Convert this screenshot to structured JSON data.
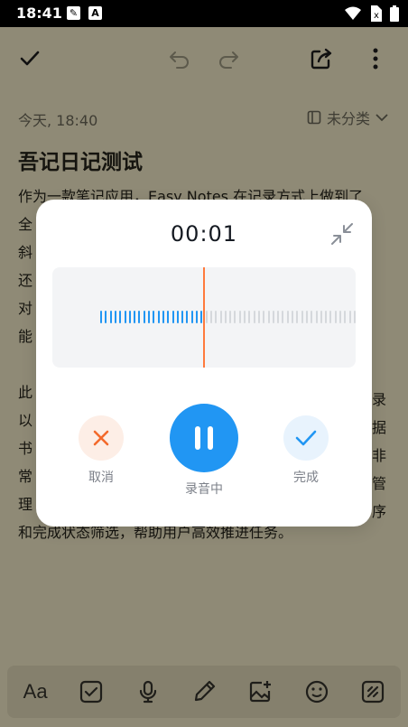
{
  "status_bar": {
    "time": "18:41",
    "icons": [
      "edit-notify-icon",
      "font-a-icon",
      "wifi-icon",
      "no-sim-icon",
      "battery-icon"
    ]
  },
  "toolbar": {
    "icons": [
      "check-icon",
      "undo-icon",
      "redo-icon",
      "share-icon",
      "more-vert-icon"
    ]
  },
  "note": {
    "date": "今天, 18:40",
    "category": "未分类",
    "title": "吾记日记测试",
    "lines": [
      "作为一款笔记应用，Easy Notes 在记录方式上做到了",
      "全",
      "斜",
      "还",
      "对",
      "能",
      "",
      "此",
      "以",
      "书",
      "常",
      "理",
      "和完成状态筛选，帮助用户高效推进任务。"
    ],
    "right_fragments": [
      "录",
      "据",
      "非",
      "管",
      "序"
    ]
  },
  "recorder": {
    "elapsed": "00:01",
    "status_label": "录音中",
    "cancel_label": "取消",
    "done_label": "完成",
    "colors": {
      "accent": "#2196f3",
      "recorded_bar": "#2196f3",
      "pending_bar": "#d5d8dc",
      "playhead": "#ff7a3d",
      "cancel": "#f36a2b"
    }
  },
  "format_bar": {
    "text_style_label": "Aa",
    "icons": [
      "checkbox-icon",
      "mic-icon",
      "brush-icon",
      "add-image-icon",
      "emoji-icon",
      "tag-icon"
    ]
  }
}
